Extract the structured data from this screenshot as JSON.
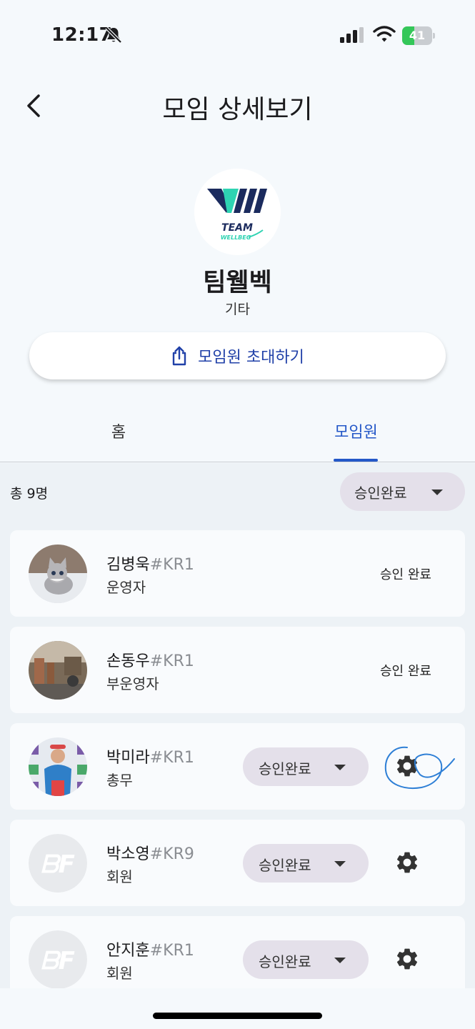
{
  "status_bar": {
    "time": "12:17",
    "battery": "41",
    "battery_level": 0.41
  },
  "header": {
    "title": "모임 상세보기"
  },
  "group": {
    "logo_text_1": "TEAM",
    "logo_text_2": "WELLBEG",
    "name": "팀웰벡",
    "category": "기타"
  },
  "invite": {
    "label": "모임원 초대하기"
  },
  "tabs": [
    {
      "label": "홈"
    },
    {
      "label": "모임원"
    }
  ],
  "members_section": {
    "total": "총 9명",
    "filter": "승인완료",
    "members": [
      {
        "name": "김병욱",
        "tag": "#KR1",
        "role": "운영자",
        "status": "승인 완료"
      },
      {
        "name": "손동우",
        "tag": "#KR1",
        "role": "부운영자",
        "status": "승인 완료"
      },
      {
        "name": "박미라",
        "tag": "#KR1",
        "role": "총무",
        "status": "승인완료"
      },
      {
        "name": "박소영",
        "tag": "#KR9",
        "role": "회원",
        "status": "승인완료"
      },
      {
        "name": "안지훈",
        "tag": "#KR1",
        "role": "회원",
        "status": "승인완료"
      }
    ]
  },
  "colors": {
    "accent": "#2458c8",
    "invite_text": "#2040a8",
    "battery_green": "#34c759",
    "scribble_blue": "#2e7fd6"
  }
}
